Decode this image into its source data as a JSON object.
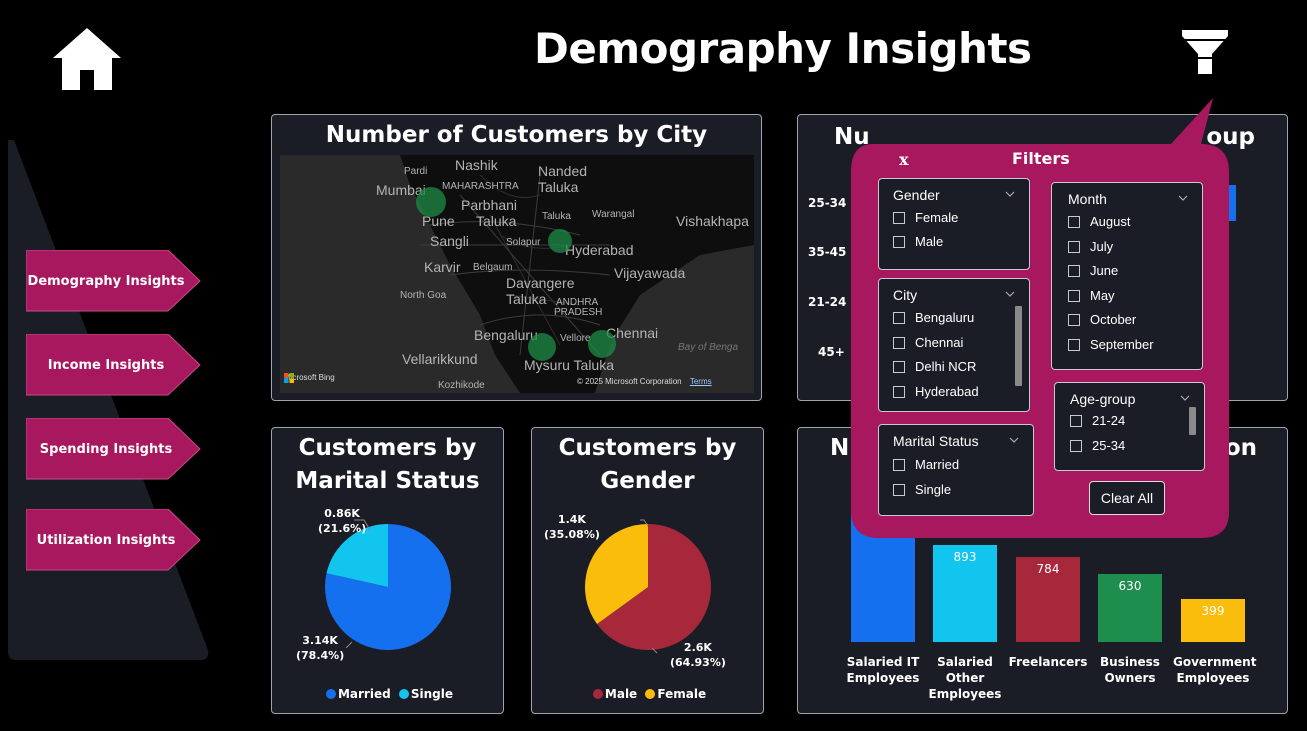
{
  "page": {
    "title": "Demography Insights"
  },
  "icons": {
    "home": "home-icon",
    "filter": "filter-icon"
  },
  "nav": {
    "items": [
      {
        "label": "Demography Insights"
      },
      {
        "label": "Income Insights"
      },
      {
        "label": "Spending Insights"
      },
      {
        "label": "Utilization Insights"
      }
    ],
    "color": "#a8185e"
  },
  "map_card": {
    "title": "Number of Customers by City",
    "labels": [
      "Nashik",
      "Pardi",
      "Nanded",
      "Mumbai",
      "MAHARASHTRA",
      "Taluka",
      "Parbhani",
      "Pune",
      "Taluka",
      "Taluka",
      "Warangal",
      "Vishakhapa",
      "Sangli",
      "Solapur",
      "Hyderabad",
      "Karvir",
      "Belgaum",
      "Vijayawada",
      "North Goa",
      "Davangere",
      "Taluka",
      "ANDHRA",
      "PRADESH",
      "Bengaluru",
      "Vellore",
      "Chennai",
      "Vellarikkund",
      "Mysuru Taluka",
      "Bay of Benga",
      "Kozhikode"
    ],
    "attribution": "Microsoft Bing",
    "copyright": "© 2025 Microsoft Corporation",
    "terms": "Terms"
  },
  "marital_card": {
    "title_line1": "Customers by",
    "title_line2": "Marital Status",
    "labels": {
      "single_value": "0.86K",
      "single_pct": "(21.6%)",
      "married_value": "3.14K",
      "married_pct": "(78.4%)"
    },
    "legend": [
      "Married",
      "Single"
    ]
  },
  "gender_card": {
    "title_line1": "Customers by",
    "title_line2": "Gender",
    "labels": {
      "female_value": "1.4K",
      "female_pct": "(35.08%)",
      "male_value": "2.6K",
      "male_pct": "(64.93%)"
    },
    "legend": [
      "Male",
      "Female"
    ]
  },
  "age_card": {
    "title_visible_left": "Nu",
    "title_visible_right": "oup",
    "rows": [
      "25-34",
      "35-45",
      "21-24",
      "45+"
    ]
  },
  "occupation_card": {
    "title_visible_left": "N",
    "title_visible_right": "on"
  },
  "filters": {
    "title": "Filters",
    "close": "x",
    "gender": {
      "label": "Gender",
      "options": [
        "Female",
        "Male"
      ]
    },
    "city": {
      "label": "City",
      "options": [
        "Bengaluru",
        "Chennai",
        "Delhi NCR",
        "Hyderabad"
      ]
    },
    "marital": {
      "label": "Marital Status",
      "options": [
        "Married",
        "Single"
      ]
    },
    "month": {
      "label": "Month",
      "options": [
        "August",
        "July",
        "June",
        "May",
        "October",
        "September"
      ]
    },
    "agegroup": {
      "label": "Age-group",
      "options": [
        "21-24",
        "25-34"
      ]
    },
    "clear_all": "Clear All",
    "accent": "#a8185e"
  },
  "chart_data": [
    {
      "type": "pie",
      "title": "Customers by Marital Status",
      "categories": [
        "Married",
        "Single"
      ],
      "values": [
        3140,
        860
      ],
      "percent": [
        78.4,
        21.6
      ],
      "colors": [
        "#1570ef",
        "#12c5ef"
      ],
      "legend": "bottom"
    },
    {
      "type": "pie",
      "title": "Customers by Gender",
      "categories": [
        "Male",
        "Female"
      ],
      "values": [
        2600,
        1400
      ],
      "percent": [
        64.93,
        35.08
      ],
      "colors": [
        "#a6283a",
        "#fbbd0c"
      ],
      "legend": "bottom"
    },
    {
      "type": "bar",
      "categories": [
        "Salaried IT Employees",
        "Salaried Other Employees",
        "Freelancers",
        "Business Owners",
        "Government Employees"
      ],
      "category_lines": [
        [
          "Salaried IT",
          "Employees"
        ],
        [
          "Salaried",
          "Other",
          "Employees"
        ],
        [
          "Freelancers"
        ],
        [
          "Business",
          "Owners"
        ],
        [
          "Government",
          "Employees"
        ]
      ],
      "values": [
        null,
        893,
        784,
        630,
        399
      ],
      "value_labels": [
        "",
        "893",
        "784",
        "630",
        "399"
      ],
      "colors": [
        "#1570ef",
        "#12c5ef",
        "#a6283a",
        "#1e8e4f",
        "#fbbd0c"
      ]
    }
  ]
}
